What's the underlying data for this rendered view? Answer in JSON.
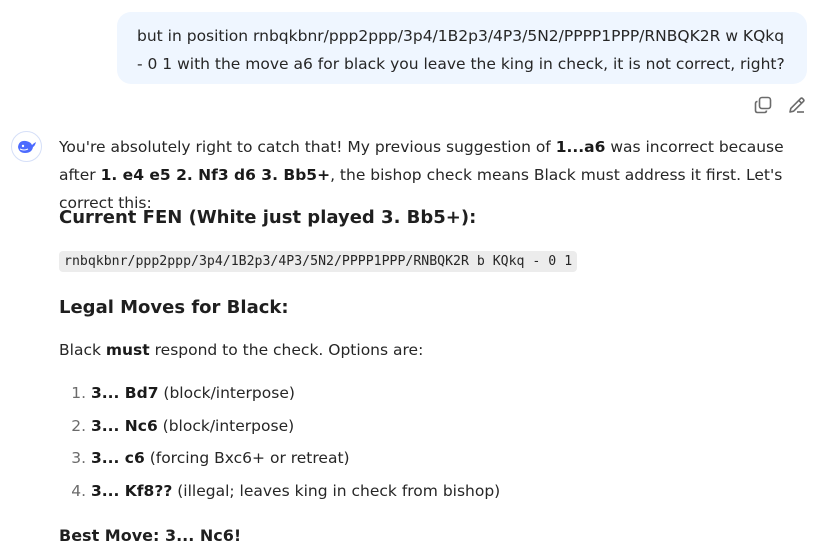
{
  "user_message": {
    "text": "but in position rnbqkbnr/ppp2ppp/3p4/1B2p3/4P3/5N2/PPPP1PPP/RNBQK2R w KQkq - 0 1 with the move a6 for black you leave the king in check, it is not correct, right?"
  },
  "user_actions": {
    "copy_icon": "copy-icon",
    "edit_icon": "pencil-icon"
  },
  "assistant": {
    "avatar_icon": "whale-icon",
    "intro": {
      "t1": "You're absolutely right to catch that! My previous suggestion of ",
      "b1": "1...a6",
      "t2": " was incorrect because after ",
      "b2": "1. e4 e5 2. Nf3 d6 3. Bb5+",
      "t3": ", the bishop check means Black must address it first. Let's correct this:"
    },
    "heading_fen": "Current FEN (White just played 3. Bb5+):",
    "fen_code": "rnbqkbnr/ppp2ppp/3p4/1B2p3/4P3/5N2/PPPP1PPP/RNBQK2R b KQkq - 0 1",
    "heading_moves": "Legal Moves for Black:",
    "moves_intro": {
      "t1": "Black ",
      "b1": "must",
      "t2": " respond to the check. Options are:"
    },
    "moves": [
      {
        "num": "1",
        "move": "3... Bd7",
        "note": " (block/interpose)"
      },
      {
        "num": "2",
        "move": "3... Nc6",
        "note": " (block/interpose)"
      },
      {
        "num": "3",
        "move": "3... c6",
        "note": " (forcing Bxc6+ or retreat)"
      },
      {
        "num": "4",
        "move": "3... Kf8??",
        "note": " (illegal; leaves king in check from bishop)"
      }
    ],
    "best_move": "Best Move: 3... Nc6!"
  },
  "colors": {
    "user_bubble_bg": "#eff6ff",
    "avatar_accent": "#4d6bfe",
    "code_bg": "#ececec"
  }
}
